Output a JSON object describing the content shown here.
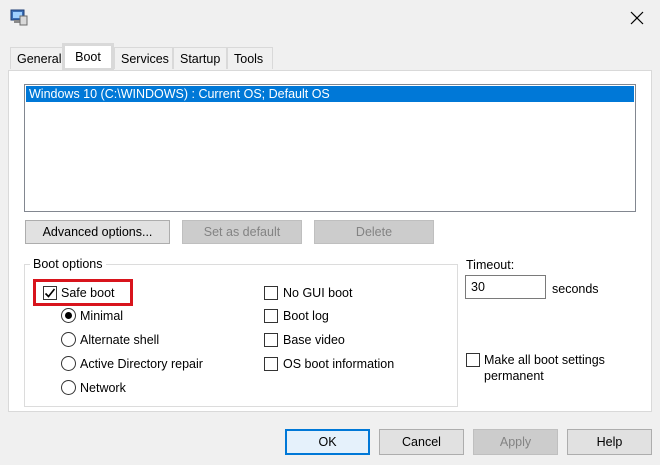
{
  "tabs": [
    "General",
    "Boot",
    "Services",
    "Startup",
    "Tools"
  ],
  "active_tab": "Boot",
  "os_list": {
    "entries": [
      "Windows 10 (C:\\WINDOWS) : Current OS; Default OS"
    ],
    "selected_index": 0
  },
  "os_buttons": {
    "advanced": "Advanced options...",
    "set_default": "Set as default",
    "delete": "Delete"
  },
  "boot_options": {
    "legend": "Boot options",
    "safe_boot": {
      "label": "Safe boot",
      "checked": true
    },
    "safe_boot_modes": [
      {
        "label": "Minimal",
        "selected": true
      },
      {
        "label": "Alternate shell",
        "selected": false
      },
      {
        "label": "Active Directory repair",
        "selected": false
      },
      {
        "label": "Network",
        "selected": false
      }
    ],
    "flags": [
      {
        "label": "No GUI boot",
        "checked": false
      },
      {
        "label": "Boot log",
        "checked": false
      },
      {
        "label": "Base video",
        "checked": false
      },
      {
        "label": "OS boot information",
        "checked": false
      }
    ]
  },
  "timeout": {
    "label": "Timeout:",
    "value": "30",
    "unit": "seconds"
  },
  "make_permanent": {
    "line1": "Make all boot settings",
    "line2": "permanent",
    "checked": false
  },
  "dialog_buttons": {
    "ok": "OK",
    "cancel": "Cancel",
    "apply": "Apply",
    "help": "Help"
  },
  "colors": {
    "selection": "#0078d7",
    "highlight_box": "#d8141c"
  }
}
